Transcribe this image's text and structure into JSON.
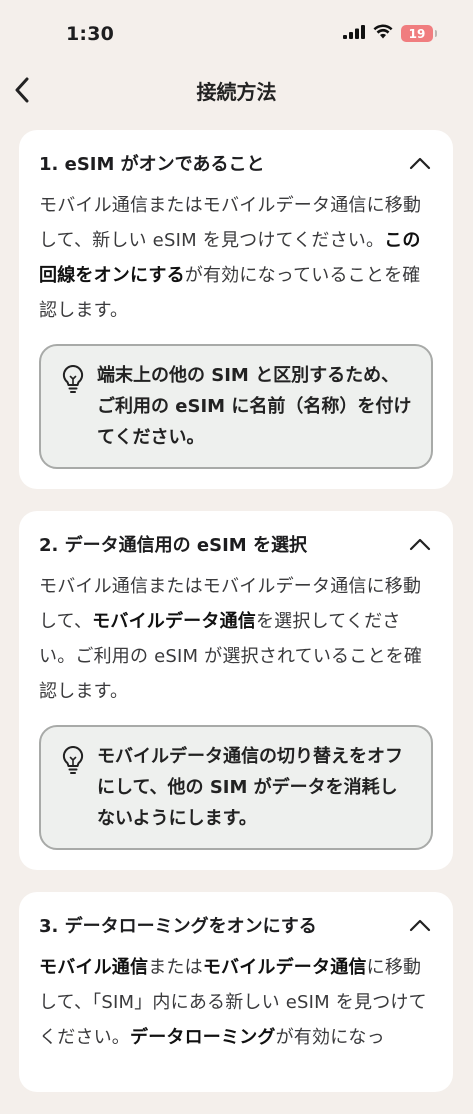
{
  "status": {
    "time": "1:30",
    "battery": "19"
  },
  "nav": {
    "title": "接続方法"
  },
  "cards": [
    {
      "title": "1. eSIM がオンであること",
      "body": [
        {
          "t": "モバイル通信またはモバイルデータ通信に移動して、新しい eSIM を見つけてください。",
          "b": false
        },
        {
          "t": "この回線をオンにする",
          "b": true
        },
        {
          "t": "が有効になっていることを確認します。",
          "b": false
        }
      ],
      "tip": "端末上の他の SIM と区別するため、ご利用の eSIM に名前（名称）を付けてください。"
    },
    {
      "title": "2. データ通信用の eSIM を選択",
      "body": [
        {
          "t": "モバイル通信またはモバイルデータ通信に移動して、",
          "b": false
        },
        {
          "t": "モバイルデータ通信",
          "b": true
        },
        {
          "t": "を選択してください。ご利用の eSIM が選択されていることを確認します。",
          "b": false
        }
      ],
      "tip": "モバイルデータ通信の切り替えをオフにして、他の SIM がデータを消耗しないようにします。"
    },
    {
      "title": "3. データローミングをオンにする",
      "body": [
        {
          "t": "モバイル通信",
          "b": true
        },
        {
          "t": "または",
          "b": false
        },
        {
          "t": "モバイルデータ通信",
          "b": true
        },
        {
          "t": "に移動して、「SIM」内にある新しい eSIM を見つけてください。",
          "b": false
        },
        {
          "t": "データローミング",
          "b": true
        },
        {
          "t": "が有効になっ",
          "b": false
        }
      ],
      "tip": ""
    }
  ]
}
